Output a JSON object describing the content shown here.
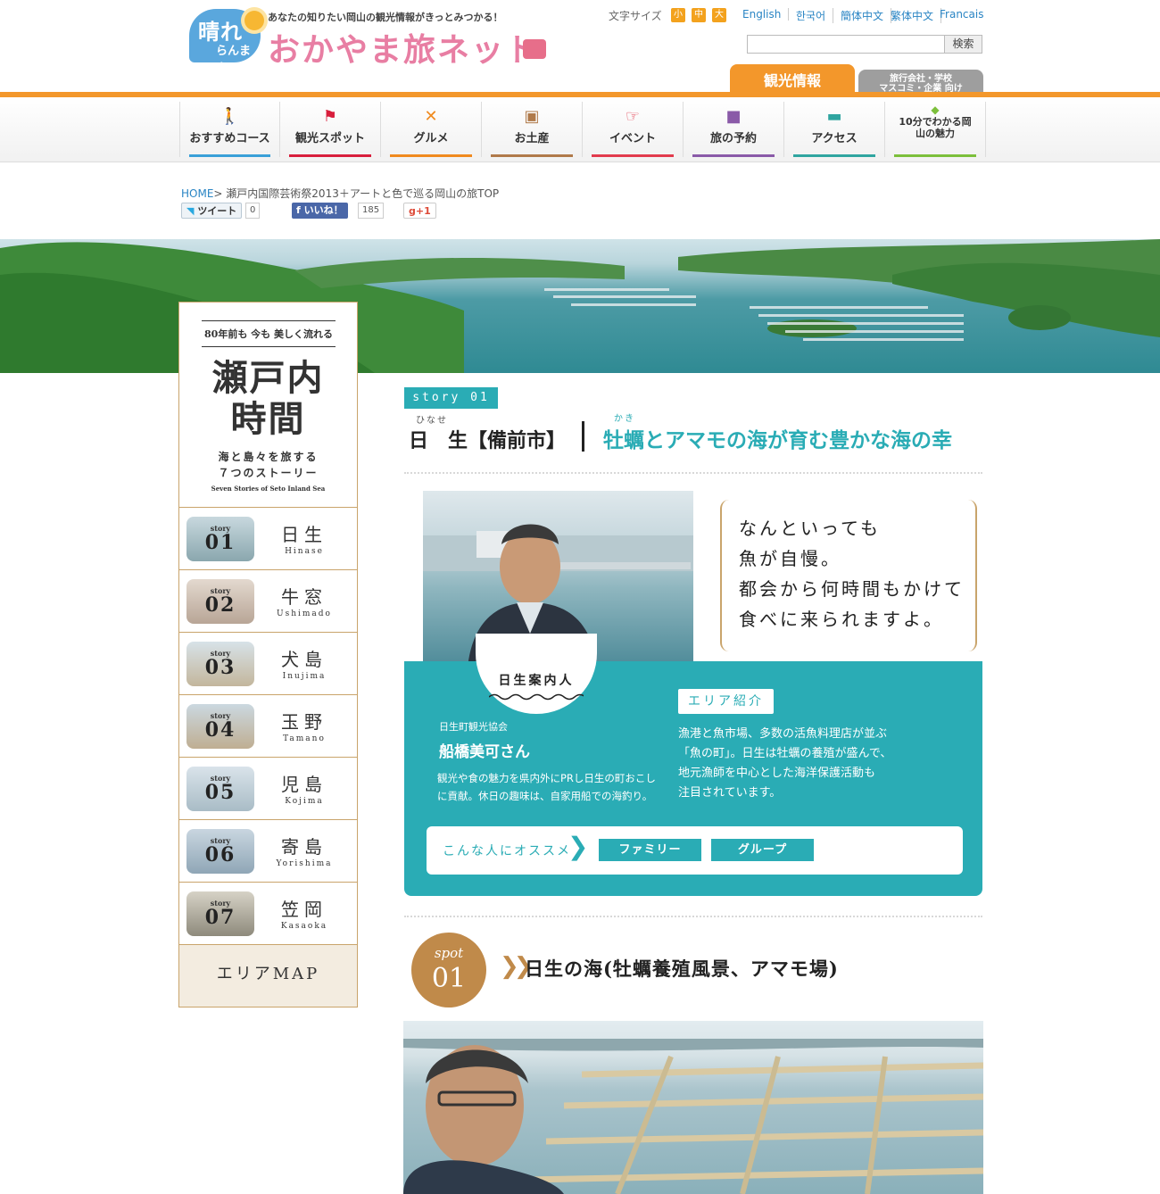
{
  "header": {
    "logo_line1": "晴れ",
    "logo_line2": "らんまん",
    "tagline": "あなたの知りたい岡山の観光情報がきっとみつかる！",
    "site_title": "おかやま旅ネット",
    "fontsize_label": "文字サイズ",
    "fontsize_options": [
      "小",
      "中",
      "大"
    ],
    "languages": [
      "English",
      "한국어",
      "簡体中文",
      "繁体中文",
      "Francais"
    ],
    "search_button": "検索",
    "tab_kanko": "観光情報",
    "tab_travel_line1": "旅行会社・学校",
    "tab_travel_line2": "マスコミ・企業 向け"
  },
  "nav": {
    "items": [
      {
        "label": "おすすめコース",
        "icon": "walker-icon",
        "color": "#3aa0d8"
      },
      {
        "label": "観光スポット",
        "icon": "flag-icon",
        "color": "#d81e3c"
      },
      {
        "label": "グルメ",
        "icon": "cutlery-icon",
        "color": "#f08a1e"
      },
      {
        "label": "お土産",
        "icon": "gift-icon",
        "color": "#b07a4a"
      },
      {
        "label": "イベント",
        "icon": "pointing-hand-icon",
        "color": "#e23b4d"
      },
      {
        "label": "旅の予約",
        "icon": "suitcase-icon",
        "color": "#8a5aa8"
      },
      {
        "label": "アクセス",
        "icon": "car-icon",
        "color": "#2fa5a0"
      },
      {
        "label": "10分でわかる岡山の魅力",
        "icon": "beginner-mark-icon",
        "color": "#7cbf3b"
      }
    ]
  },
  "breadcrumb": {
    "home": "HOME",
    "separator": ">",
    "current": "瀬戸内国際芸術祭2013＋アートと色で巡る岡山の旅TOP"
  },
  "social": {
    "tweet_label": "ツイート",
    "tweet_count": "0",
    "like_label": "いいね！",
    "like_count": "185",
    "gplus_label": "g+1"
  },
  "sidebar": {
    "subtitle": "80年前も 今も 美しく流れる",
    "title_line1": "瀬戸内",
    "title_line2": "時間",
    "desc_line1": "海と島々を旅する",
    "desc_line2": "７つのストーリー",
    "desc_en": "Seven Stories of Seto Inland Sea",
    "story_label": "story",
    "stories": [
      {
        "num": "01",
        "name": "日生",
        "roman": "Hinase"
      },
      {
        "num": "02",
        "name": "牛窓",
        "roman": "Ushimado"
      },
      {
        "num": "03",
        "name": "犬島",
        "roman": "Inujima"
      },
      {
        "num": "04",
        "name": "玉野",
        "roman": "Tamano"
      },
      {
        "num": "05",
        "name": "児島",
        "roman": "Kojima"
      },
      {
        "num": "06",
        "name": "寄島",
        "roman": "Yorishima"
      },
      {
        "num": "07",
        "name": "笠岡",
        "roman": "Kasaoka"
      }
    ],
    "area_map": "エリアMAP"
  },
  "main": {
    "story_tag": "story 01",
    "ruby_hinase": "ひなせ",
    "ruby_kaki": "かき",
    "place": "日　生【備前市】",
    "subtitle": "牡蠣とアマモの海が育む豊かな海の幸",
    "quote_lines": [
      "なんといっても",
      "魚が自慢。",
      "都会から何時間もかけて",
      "食べに来られますよ。"
    ],
    "guide_label": "日生案内人",
    "org": "日生町観光協会",
    "person": "船橋美可さん",
    "person_desc": "観光や食の魅力を県内外にPRし日生の町おこしに貢献。休日の趣味は、自家用船での海釣り。",
    "area_tag": "エリア紹介",
    "area_desc_lines": [
      "漁港と魚市場、多数の活魚料理店が並ぶ",
      "「魚の町」。日生は牡蠣の養殖が盛んで、",
      "地元漁師を中心とした海洋保護活動も",
      "注目されています。"
    ],
    "recommend_label": "こんな人にオススメ",
    "recommend_tags": [
      "ファミリー",
      "グループ"
    ],
    "spot_word": "spot",
    "spot_num": "01",
    "spot_title": "日生の海(牡蠣養殖風景、アマモ場)"
  },
  "colors": {
    "teal": "#2aacb5",
    "orange": "#f3972b",
    "gold": "#c08a4a"
  }
}
